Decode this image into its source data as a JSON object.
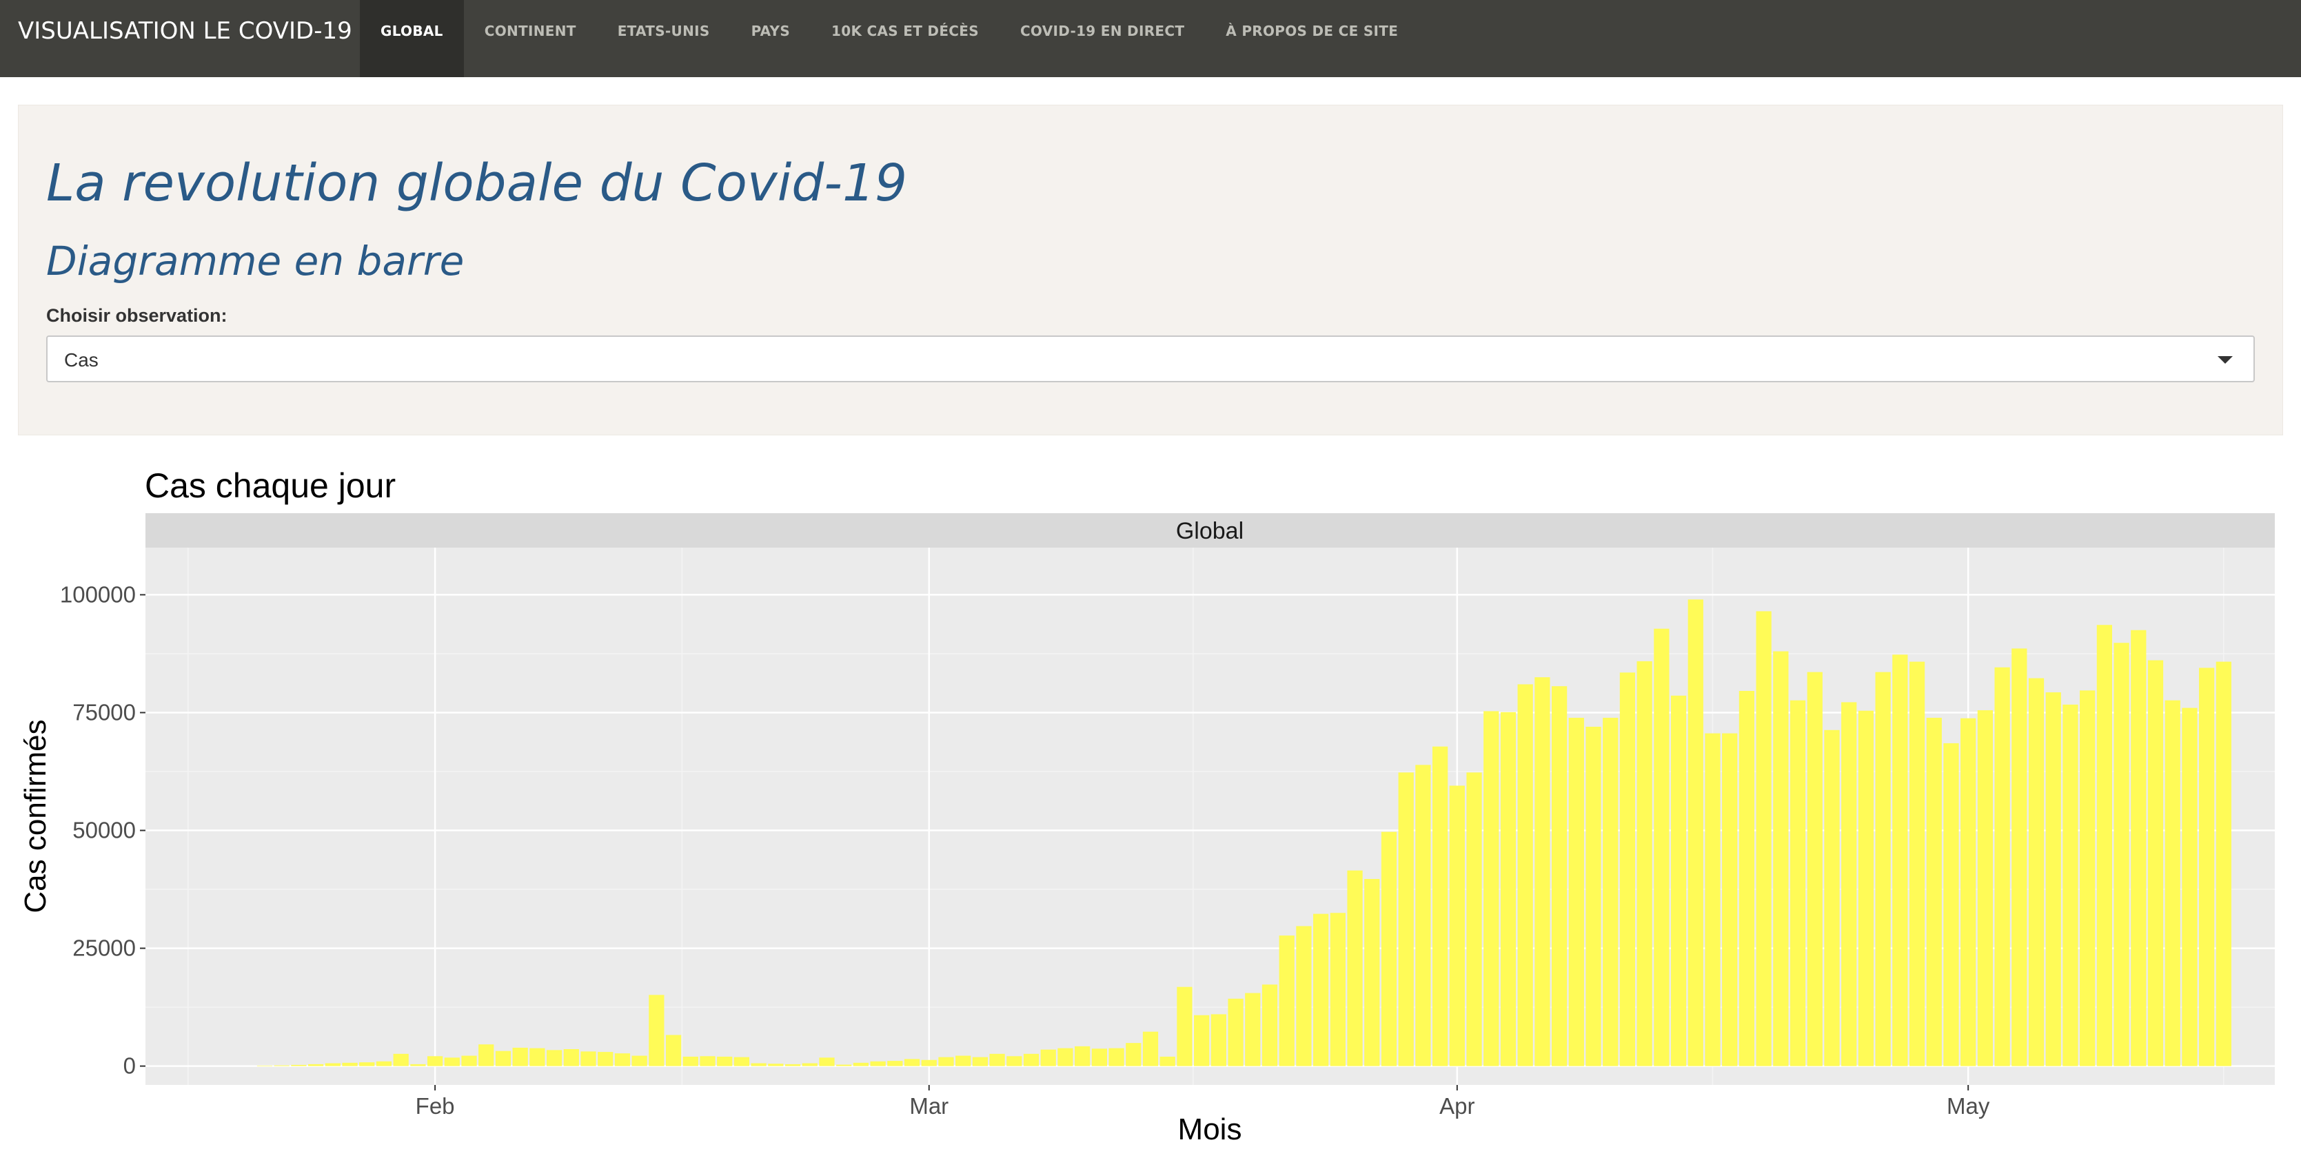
{
  "navbar": {
    "brand": "VISUALISATION LE COVID-19",
    "items": [
      {
        "label": "GLOBAL",
        "active": true
      },
      {
        "label": "CONTINENT",
        "active": false
      },
      {
        "label": "ETATS-UNIS",
        "active": false
      },
      {
        "label": "PAYS",
        "active": false
      },
      {
        "label": "10K CAS ET DÉCÈS",
        "active": false
      },
      {
        "label": "COVID-19 EN DIRECT",
        "active": false
      },
      {
        "label": "À PROPOS DE CE SITE",
        "active": false
      }
    ]
  },
  "panel": {
    "title": "La revolution globale du Covid-19",
    "subtitle": "Diagramme en barre",
    "select_label": "Choisir observation:",
    "select_value": "Cas"
  },
  "chart_data": {
    "type": "bar",
    "title": "Cas chaque jour",
    "facet_label": "Global",
    "xlabel": "Mois",
    "ylabel": "Cas confirmés",
    "ylim": [
      -4000,
      110000
    ],
    "yticks": [
      0,
      25000,
      50000,
      75000,
      100000
    ],
    "ytick_labels": [
      "0",
      "25000",
      "50000",
      "75000",
      "100000"
    ],
    "xticks": [
      {
        "date": "2020-02-01",
        "label": "Feb"
      },
      {
        "date": "2020-03-01",
        "label": "Mar"
      },
      {
        "date": "2020-04-01",
        "label": "Apr"
      },
      {
        "date": "2020-05-01",
        "label": "May"
      }
    ],
    "xlim": [
      "2020-01-15",
      "2020-05-19"
    ],
    "grid": true,
    "bar_color": "#fffb57",
    "panel_color": "#ebebeb",
    "strip_color": "#d9d9d9",
    "series": [
      {
        "dates_from": "2020-01-22",
        "dates_to": "2020-05-12",
        "values": [
          100,
          150,
          250,
          400,
          600,
          700,
          800,
          1000,
          2600,
          400,
          2100,
          1800,
          2200,
          4600,
          3200,
          3900,
          3800,
          3400,
          3600,
          3100,
          3000,
          2700,
          2200,
          15100,
          6600,
          2000,
          2100,
          2000,
          1900,
          600,
          500,
          400,
          600,
          1800,
          300,
          700,
          1000,
          1100,
          1500,
          1300,
          1900,
          2200,
          1900,
          2600,
          2100,
          2600,
          3500,
          3800,
          4200,
          3700,
          3800,
          4900,
          7300,
          2000,
          16800,
          10800,
          11000,
          14300,
          15500,
          17300,
          27700,
          29700,
          32300,
          32500,
          41500,
          39700,
          49700,
          62300,
          63900,
          67800,
          59500,
          62300,
          75300,
          75100,
          81000,
          82500,
          80600,
          73900,
          72000,
          73900,
          83500,
          85900,
          92800,
          78600,
          99000,
          70600,
          70600,
          79600,
          96500,
          88000,
          77600,
          83600,
          71300,
          77200,
          75400,
          83600,
          87300,
          85800,
          73900,
          68500,
          73800,
          75500,
          84600,
          88600,
          82300,
          79300,
          76700,
          79700,
          93600,
          89800,
          92500,
          86100,
          77600,
          76000,
          84500,
          85800
        ]
      }
    ]
  }
}
